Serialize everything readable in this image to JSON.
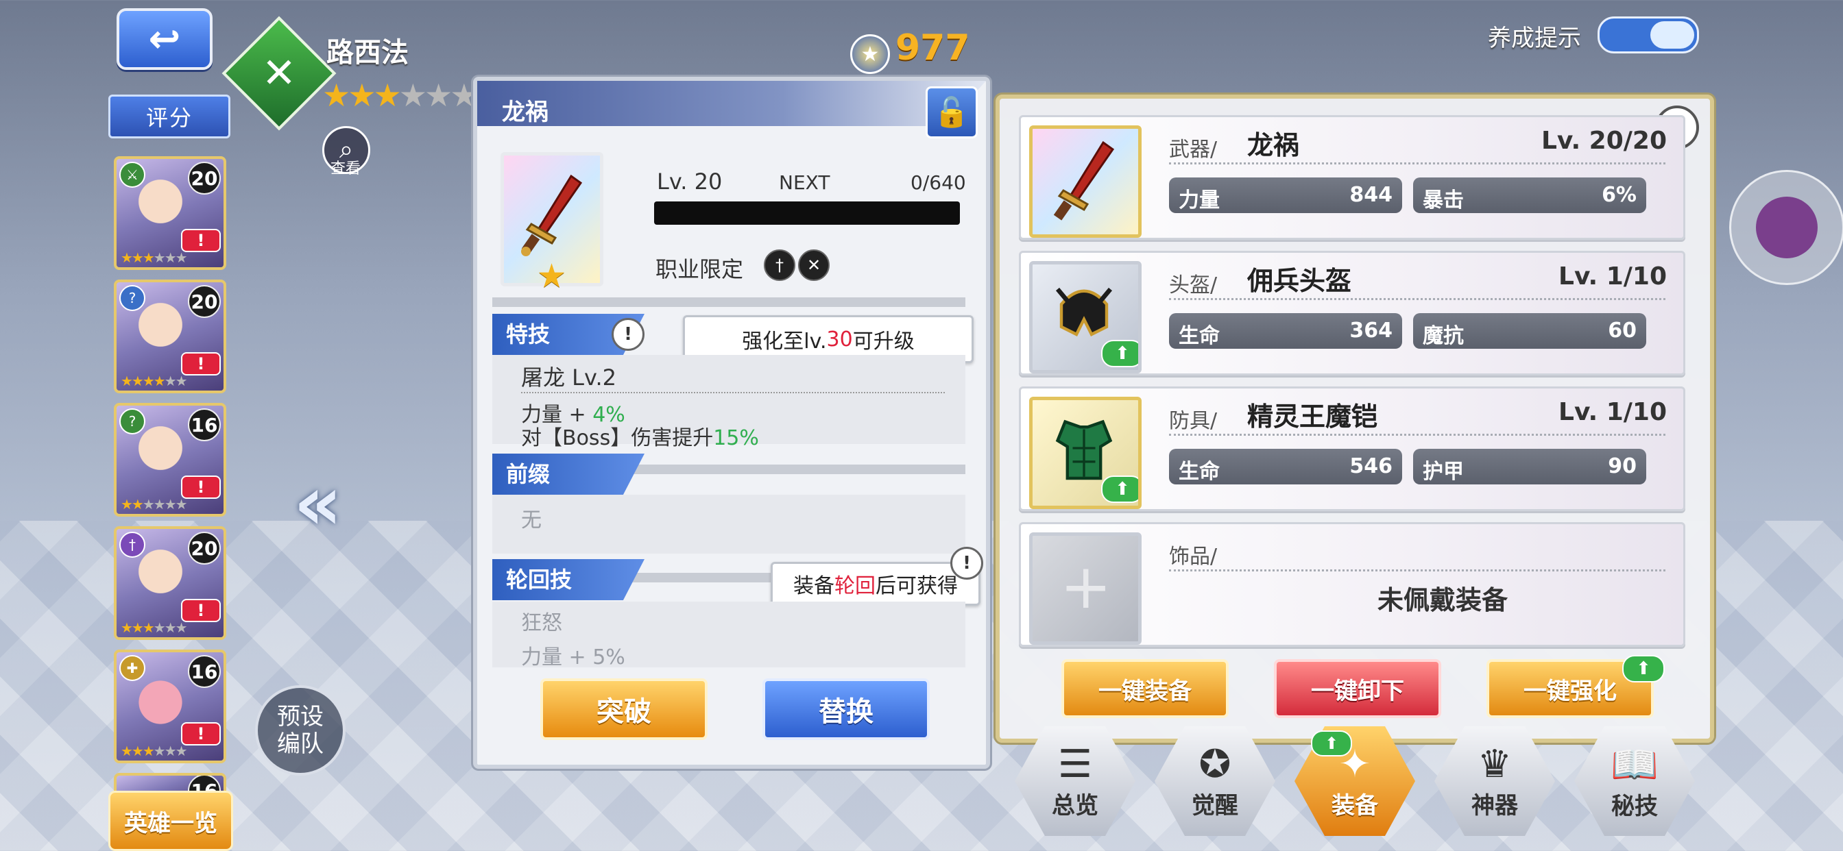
{
  "header": {
    "hero_name": "路西法",
    "hero_stars_filled": 3,
    "hero_stars_total": 6,
    "view_label": "查看",
    "power": "977",
    "training_hint_label": "养成提示"
  },
  "sidebar": {
    "rating_label": "评分",
    "heroes": [
      {
        "level": "20",
        "alert": "!",
        "stars_filled": 3
      },
      {
        "level": "20",
        "alert": "!",
        "stars_filled": 4
      },
      {
        "level": "16",
        "alert": "!",
        "stars_filled": 2
      },
      {
        "level": "20",
        "alert": "!",
        "stars_filled": 3
      },
      {
        "level": "16",
        "alert": "!",
        "stars_filled": 3
      },
      {
        "level": "16"
      }
    ],
    "hero_list_button": "英雄一览",
    "preset_button": "预设\n编队"
  },
  "weapon_detail": {
    "title": "龙祸",
    "level": "Lv. 20",
    "next_label": "NEXT",
    "exp": "0/640",
    "job_limit_label": "职业限定",
    "special_skill": {
      "tag": "特技",
      "tooltip_prefix": "强化至lv.",
      "tooltip_num": "30",
      "tooltip_suffix": "可升级",
      "name": "屠龙 Lv.2",
      "line1_prefix": "力量 + ",
      "line1_value": "4%",
      "line2_prefix": "对【Boss】伤害提升",
      "line2_value": "15%"
    },
    "prefix_section": {
      "tag": "前缀",
      "value": "无"
    },
    "reincarnation": {
      "tag": "轮回技",
      "tooltip_prefix": "装备",
      "tooltip_highlight": "轮回",
      "tooltip_suffix": "后可获得",
      "name": "狂怒",
      "line1": "力量 + 5%"
    },
    "breakthrough_button": "突破",
    "replace_button": "替换"
  },
  "equipment": {
    "help": "?",
    "slots": [
      {
        "category": "武器/",
        "name": "龙祸",
        "level": "Lv. 20/20",
        "stats": [
          {
            "k": "力量",
            "v": "844"
          },
          {
            "k": "暴击",
            "v": "6%"
          }
        ]
      },
      {
        "category": "头盔/",
        "name": "佣兵头盔",
        "level": "Lv. 1/10",
        "stats": [
          {
            "k": "生命",
            "v": "364"
          },
          {
            "k": "魔抗",
            "v": "60"
          }
        ]
      },
      {
        "category": "防具/",
        "name": "精灵王魔铠",
        "level": "Lv. 1/10",
        "stats": [
          {
            "k": "生命",
            "v": "546"
          },
          {
            "k": "护甲",
            "v": "90"
          }
        ]
      },
      {
        "category": "饰品/",
        "empty_text": "未佩戴装备"
      }
    ],
    "equip_all": "一键装备",
    "unequip_all": "一键卸下",
    "enhance_all": "一键强化"
  },
  "tabs": [
    {
      "label": "总览",
      "icon": "list-icon"
    },
    {
      "label": "觉醒",
      "icon": "awaken-icon"
    },
    {
      "label": "装备",
      "icon": "equipment-icon",
      "active": true
    },
    {
      "label": "神器",
      "icon": "artifact-icon"
    },
    {
      "label": "秘技",
      "icon": "book-icon"
    }
  ],
  "colors": {
    "accent_gold": "#f6c233",
    "accent_blue": "#2d5fcf",
    "highlight_red": "#e0213b",
    "highlight_green": "#2fae4e"
  }
}
